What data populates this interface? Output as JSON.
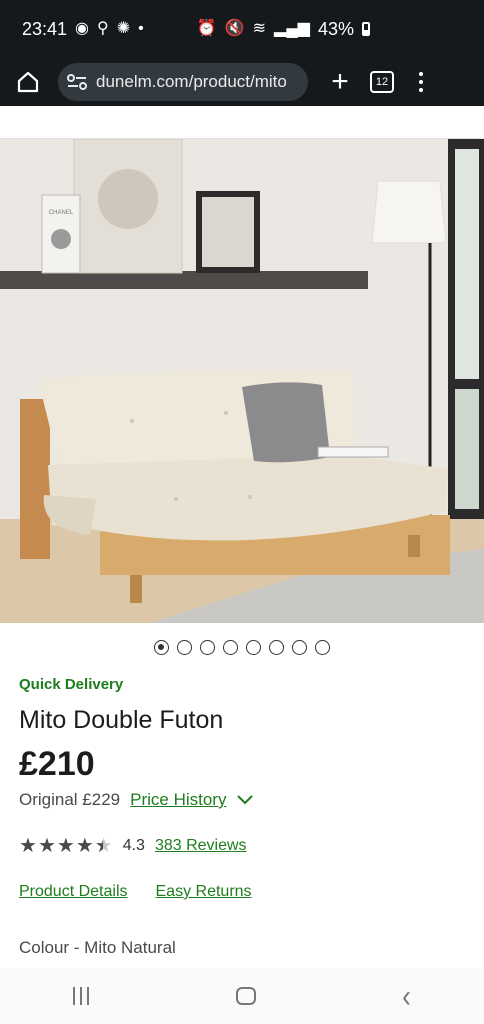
{
  "status": {
    "time": "23:41",
    "battery": "43%"
  },
  "browser": {
    "url": "dunelm.com/product/mito",
    "tab_count": "12"
  },
  "gallery": {
    "total": 8,
    "active_index": 0
  },
  "product": {
    "badge": "Quick Delivery",
    "title": "Mito Double Futon",
    "price": "£210",
    "original": "Original £229",
    "price_history": "Price History",
    "rating_value": 4.3,
    "rating_text": "4.3",
    "reviews": "383 Reviews",
    "product_details": "Product Details",
    "easy_returns": "Easy Returns",
    "colour": "Colour - Mito Natural"
  },
  "hero_image": {
    "poster_text": "CHANEL"
  },
  "colors": {
    "accent": "#1e7d1e",
    "dark_bar": "#15191c"
  }
}
